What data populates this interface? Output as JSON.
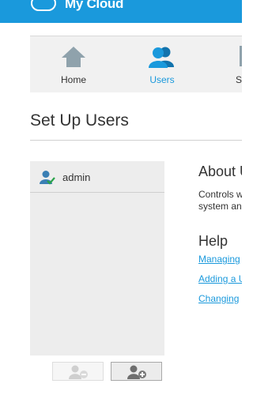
{
  "header": {
    "brand": "My Cloud",
    "trademark": "™"
  },
  "nav": {
    "items": [
      {
        "label": "Home",
        "icon": "home-icon"
      },
      {
        "label": "Users",
        "icon": "users-icon",
        "active": true
      },
      {
        "label": "S",
        "icon": "settings-icon"
      }
    ]
  },
  "page": {
    "title": "Set Up Users"
  },
  "users": [
    {
      "name": "admin",
      "icon": "admin-user-icon"
    }
  ],
  "actions": {
    "remove_icon": "remove-user-icon",
    "add_icon": "add-user-icon"
  },
  "about": {
    "heading": "About U",
    "line1": "Controls w",
    "line2": "system an"
  },
  "help": {
    "heading": "Help",
    "links": [
      "Managing",
      "Adding a U",
      "Changing"
    ]
  },
  "colors": {
    "accent": "#1a99dc",
    "panel": "#ededed",
    "nav_bg": "#f1f1f1"
  }
}
